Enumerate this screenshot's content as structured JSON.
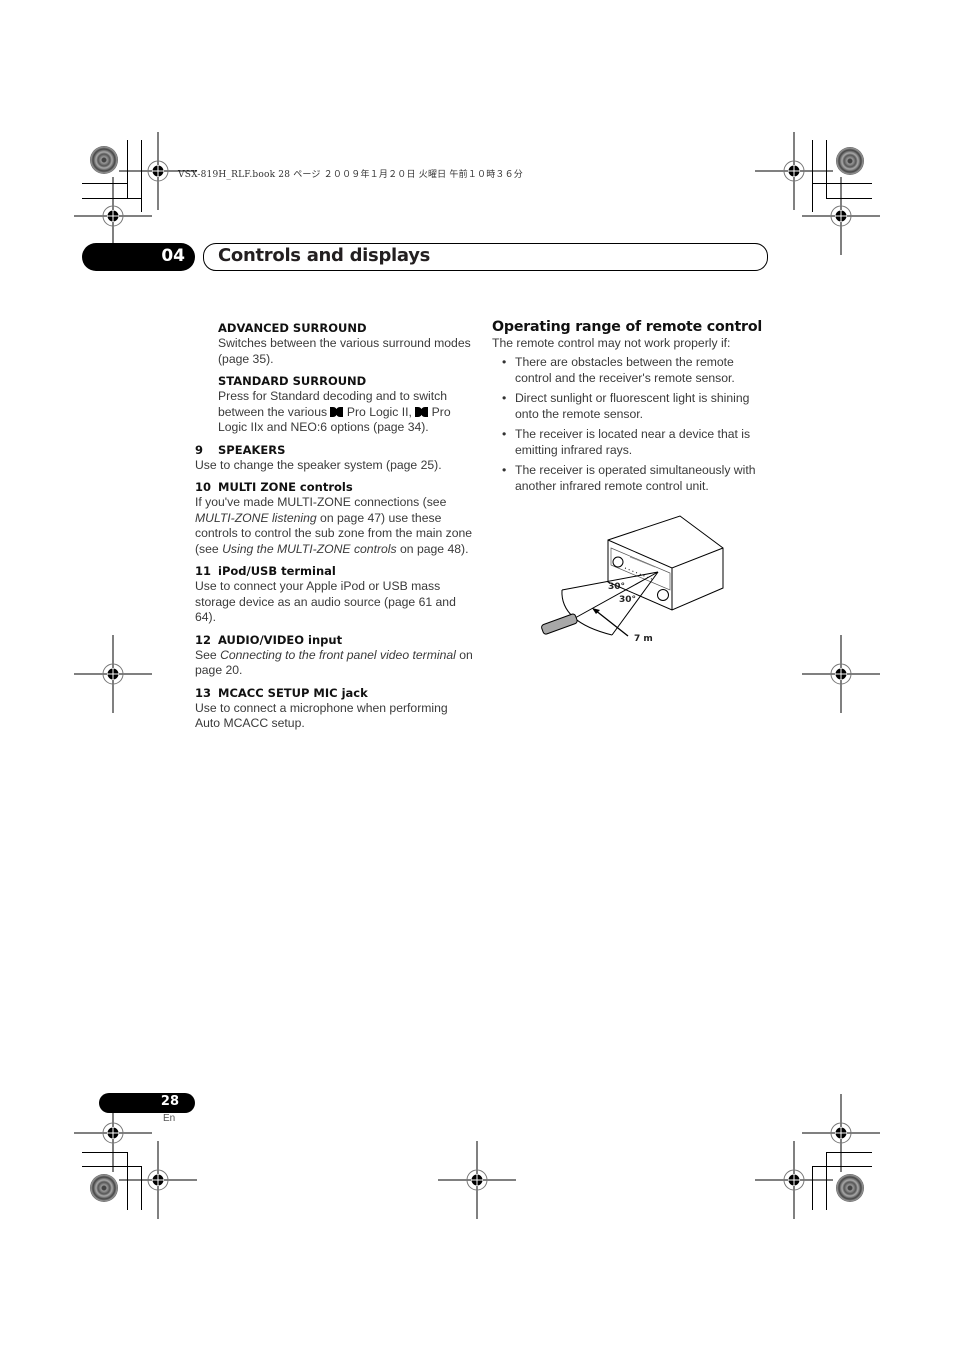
{
  "print_header": "VSX-819H_RLF.book  28 ページ  ２００９年１月２０日  火曜日  午前１０時３６分",
  "chapter": {
    "number": "04",
    "title": "Controls and displays"
  },
  "left_column": {
    "sub_items": [
      {
        "heading": "ADVANCED SURROUND",
        "text": "Switches between the various surround modes (page 35)."
      },
      {
        "heading": "STANDARD SURROUND",
        "text_parts": [
          "Press for Standard decoding and to switch between the various ",
          " Pro Logic II, ",
          " Pro Logic IIx and NEO:6 options (page 34)."
        ]
      }
    ],
    "items": [
      {
        "number": "9",
        "heading": "SPEAKERS",
        "text": "Use to change the speaker system (page 25)."
      },
      {
        "number": "10",
        "heading": "MULTI ZONE controls",
        "text_parts": [
          "If you've made MULTI-ZONE connections (see ",
          "MULTI-ZONE listening",
          " on page 47) use these controls to control the sub zone from the main zone (see ",
          "Using the MULTI-ZONE controls",
          " on page 48)."
        ]
      },
      {
        "number": "11",
        "heading": "iPod/USB terminal",
        "text": "Use to connect your Apple iPod or USB mass storage device as an audio source (page 61 and 64)."
      },
      {
        "number": "12",
        "heading": "AUDIO/VIDEO input",
        "text_parts": [
          "See ",
          "Connecting to the front panel video terminal",
          " on page 20."
        ]
      },
      {
        "number": "13",
        "heading": "MCACC SETUP MIC jack",
        "text": "Use to connect a microphone when performing Auto MCACC setup."
      }
    ]
  },
  "right_column": {
    "section_title": "Operating range of remote control",
    "intro": "The remote control may not work properly if:",
    "bullets": [
      "There are obstacles between the remote control and the receiver's remote sensor.",
      "Direct sunlight or fluorescent light is shining onto the remote sensor.",
      "The receiver is located near a device that is emitting infrared rays.",
      "The receiver is operated simultaneously with another infrared remote control unit."
    ],
    "figure": {
      "angle_upper": "30°",
      "angle_lower": "30°",
      "distance": "7 m"
    }
  },
  "footer": {
    "page_number": "28",
    "language": "En"
  },
  "icons": {
    "dolby_logo": "double-D-icon",
    "registration": "crop-registration-mark-icon",
    "rosette": "color-rosette-icon"
  }
}
